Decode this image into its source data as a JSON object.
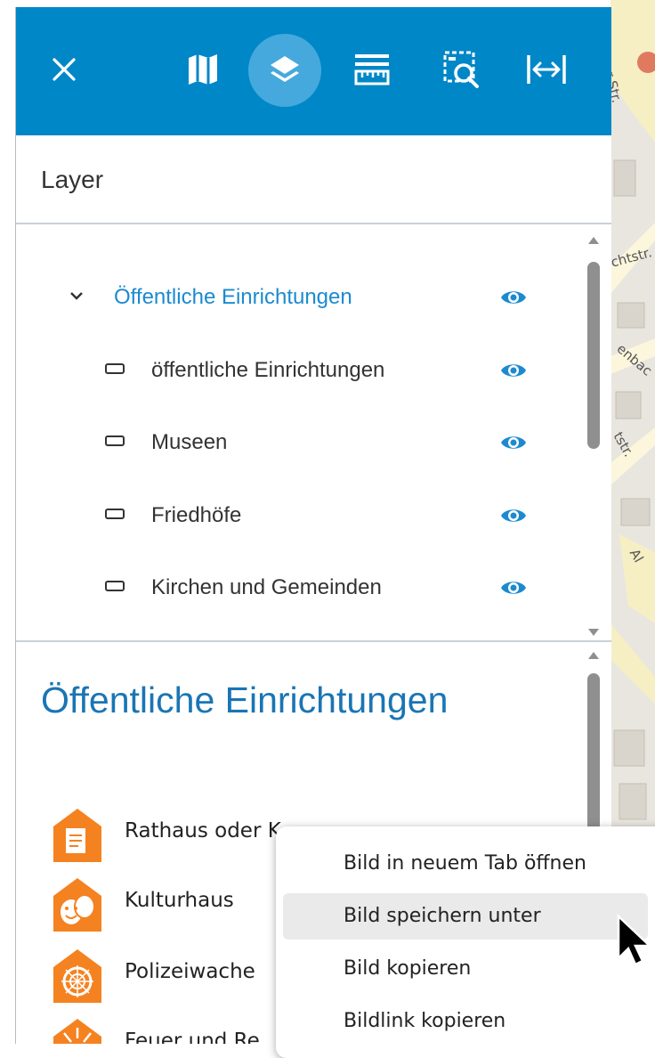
{
  "map": {
    "labels": [
      "ger Str.",
      "chtstr.",
      "enbac",
      "tstr.",
      "Al"
    ]
  },
  "toolbar": {
    "buttons": [
      {
        "icon": "close-icon"
      },
      {
        "icon": "map-icon"
      },
      {
        "icon": "layers-icon",
        "active": true
      },
      {
        "icon": "ruler-icon"
      },
      {
        "icon": "zoom-area-icon"
      },
      {
        "icon": "width-measure-icon"
      }
    ],
    "accent": "#0087c7",
    "active_bg": "#45a9dd"
  },
  "layer_panel": {
    "title": "Layer",
    "group": {
      "label": "Öffentliche Einrichtungen",
      "expanded": true,
      "visible": true
    },
    "items": [
      {
        "label": "öffentliche Einrichtungen",
        "visible": true
      },
      {
        "label": "Museen",
        "visible": true
      },
      {
        "label": "Friedhöfe",
        "visible": true
      },
      {
        "label": "Kirchen und Gemeinden",
        "visible": true
      }
    ]
  },
  "legend": {
    "title": "Öffentliche Einrichtungen",
    "items": [
      {
        "label": "Rathaus oder K",
        "icon": "town-hall-icon"
      },
      {
        "label": "Kulturhaus",
        "icon": "theater-masks-icon"
      },
      {
        "label": "Polizeiwache",
        "icon": "police-badge-icon"
      },
      {
        "label": "Feuer und Re",
        "icon": "fire-station-icon"
      }
    ],
    "icon_color": "#f58220"
  },
  "context_menu": {
    "items": [
      {
        "label": "Bild in neuem Tab öffnen"
      },
      {
        "label": "Bild speichern unter",
        "highlighted": true
      },
      {
        "label": "Bild kopieren"
      },
      {
        "label": "Bildlink kopieren"
      }
    ]
  }
}
